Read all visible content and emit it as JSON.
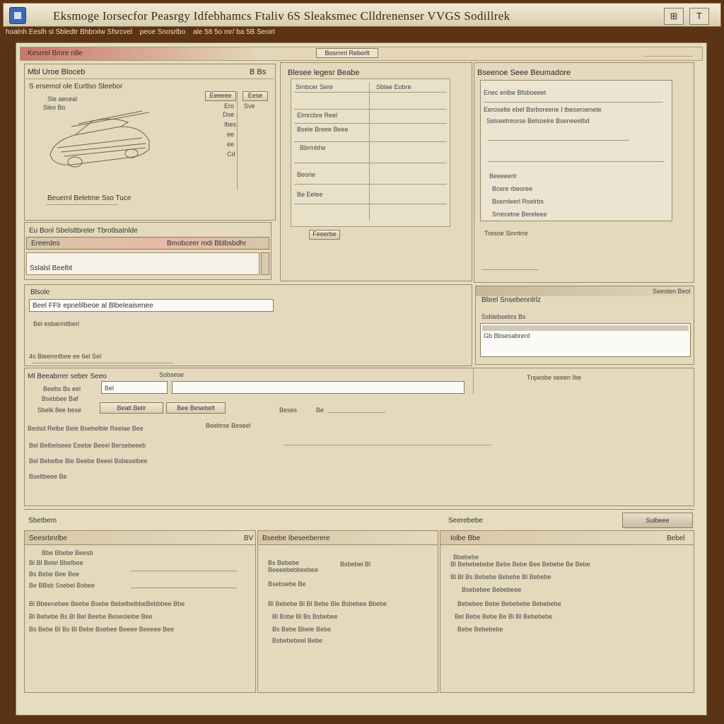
{
  "window": {
    "title": "Eksmoge Iorsecfor Peasrgy Idfebhamcs Ftaliv 6S Sleaksmec Clldrenenser VVGS Sodillrek",
    "buttons": [
      "⊞",
      "T"
    ]
  },
  "menubar": [
    "hoalnh Eeslh sl Sbledtr Bhbrxlw Sfsrcvel",
    "peoe Snosrlbo",
    "ale 58 5o mr/ ba 5B Seoirl"
  ],
  "header": {
    "left": "Kesrrel Bmre rdle",
    "center": "Bosrnrrl Reborlt"
  },
  "vehicle_panel": {
    "title": "Mbl Uroe Bloceb",
    "title_right": "B  Bs",
    "subtitle": "S ersemol ole Eurtlso Sleebor",
    "labels": [
      "Sle aeceal",
      "Sleo Bo"
    ],
    "right_buttons": [
      "Eeeeee",
      "Eese"
    ],
    "values": [
      "Ero",
      "Sve",
      "Dse",
      "Ibes",
      "ee",
      "ee",
      "Cd"
    ],
    "footer": "Beuernl Beletme Sso Tuce"
  },
  "fault_panel": {
    "title": "Eu Bonl Sbelsltbreler  Tbrotlsatnlde",
    "row_left": "Ereerdes",
    "row_right": "Bmobceer mdi Bblbsbdhr",
    "footer": "Sslalsl Beelbt"
  },
  "data_panel": {
    "title": "Blesee legesr Beabe",
    "rows": [
      "Srnbcer Sere",
      "Sblae Eobre",
      "Elmrcbre Reel",
      "Bsele Breee Beee",
      "Bbrmbhe",
      "Beorie",
      "Be  Eelee"
    ],
    "button": "Feeerbe"
  },
  "adapter_panel": {
    "title": "Bseenoe Seee Beumadore",
    "rows": [
      "Enec enlbe  Bfsboeeet",
      "Eeroselte ebel Bsrboreene I  tbeseroenete",
      "Selseetreorse  Belsoelre Bseneeelbd",
      "Beeeeerlr",
      "Bcere rbeoree",
      "Bsemleerl Rselrbs",
      "Srrecetne Bereleee"
    ],
    "footer": "Tresoe Sinntrre"
  },
  "controller_panel": {
    "title": "Blsole",
    "input_value": "Beel FFlr  epnelilbeoe al  Blbeleaisenee",
    "rows": [
      "Bel esbarmtlberl",
      "4s Bleemnlbee ee 6el Sel"
    ]
  },
  "channel_panel": {
    "title": "Bbrel Snsebennlrlz",
    "right": "Seeolen Beol",
    "row": "Ssblebsebrs Bs",
    "list_item": "Gb  Bbsesabrerd"
  },
  "measure_panel": {
    "title": "Ml Beeabrrer seber Seeo",
    "tab": "Sobsese",
    "labels": [
      "Beebs  Bs eel",
      "Bsebbee  Baf",
      "Sbelk 8ee bese"
    ],
    "input_value": "Bel",
    "buttons": [
      "Beatl Belir",
      "Bee Besebelt"
    ],
    "mid_label": "Beses",
    "mid_value": "Be",
    "rows": [
      "Bedsd Relbe  Bele Bsebelble Reelae  Bee",
      "Bel Belbelseee  Eeebe  Beeel Bersebeeeb",
      "Bel Bebelbe Ble Beebe Beeel Bsbeselbee",
      "Bseltbeee  Be"
    ],
    "row_right": "Beebrse Beseel",
    "right_label": "Tnpesbe seeen Ibe"
  },
  "bottom_bar": {
    "left": "Sbetbem",
    "center": "Seerebebe",
    "right": "Sulbeee"
  },
  "bottom_left": {
    "title": "Seesrbnrlbe",
    "title_right": "BV",
    "rows": [
      "Bbe  Bbebe Beesb",
      "Bl  Bl  Belel  Bbelbee",
      "Bs  Bebe Bee Bee",
      "Be BBsb  Ssebel  Bsbee"
    ],
    "detail_rows": [
      "Bl  Bbeenebee  Beebe  Bsebe BebelbelbbeBebbbee Bbe",
      "Bl  Bebebe Bs Bl Bel Beebe  Beseoleibe  Bee",
      "Bs  Bebe Bl Bs Bl Bebe Bsebee Beeee  Beeeee Bee"
    ]
  },
  "bottom_mid": {
    "title": "Bseebe Ibeseeberere",
    "rows": [
      "Bs  Bebebe",
      "Beeeebebbeebee",
      "Bsebsebe Be"
    ],
    "right_rows": [
      "Bsbebel  Bl"
    ],
    "detail_rows": [
      "Bl  Bebebe  Bl Bl Bebe Ble  Bsbebee  Bbebe",
      "Bl Bsbe Bl Bs Bsbebee",
      "Bs  Bebe Bbele Bebe",
      "Bsbebebeel Bebe"
    ]
  },
  "bottom_right": {
    "title": "Iolbe Bbe",
    "title_right": "Bebel",
    "rows": [
      "Bbebebe",
      "Bl Bebebebebe Bebe Bebe Bee Bebebe Be Bebe",
      "Bl  Bl Bs Bebebe Bebebe Bl Bebebe",
      "Bsebebee Bebebeee",
      "Bebebee  Bebe Bebebebe Bebebebe",
      "Bel  Bebe  Bebe Be  Bl Bl Bebebebe",
      "Bebe Bebebebe"
    ]
  }
}
